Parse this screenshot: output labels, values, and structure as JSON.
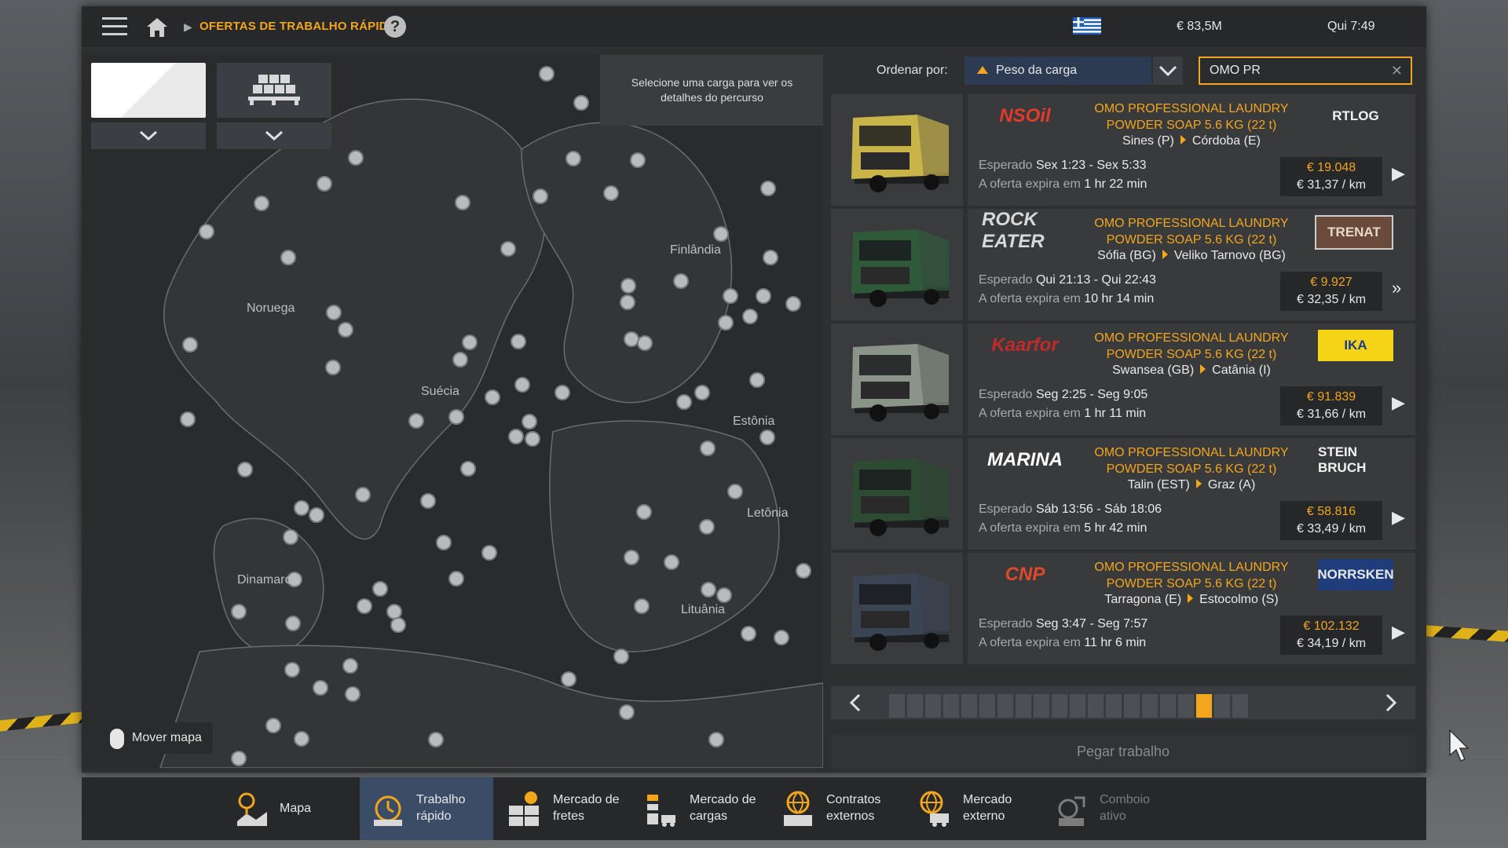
{
  "header": {
    "breadcrumb_title": "OFERTAS DE TRABALHO RÁPIDO",
    "help": "?",
    "money": "€ 83,5M",
    "time": "Qui 7:49"
  },
  "map": {
    "tooltip": "Selecione uma carga para ver os detalhes do percurso",
    "labels": [
      "Noruega",
      "Suécia",
      "Finlândia",
      "Estônia",
      "Letônia",
      "Lituânia",
      "Dinamarca"
    ],
    "move_map": "Mover mapa"
  },
  "sort": {
    "label": "Ordenar por:",
    "value": "Peso da carga"
  },
  "search": {
    "value": "OMO PR",
    "clear": "✕"
  },
  "jobs": [
    {
      "company": "NSOil",
      "cargo_line1": "OMO PROFESSIONAL LAUNDRY",
      "cargo_line2": "POWDER SOAP 5.6 KG (22 t)",
      "from": "Sines (P)",
      "to": "Córdoba (E)",
      "expected_label": "Esperado",
      "expected": "Sex 1:23 - Sex 5:33",
      "expires_label": "A oferta expira em",
      "expires": "1 hr 22 min",
      "price": "€ 19.048",
      "per_km": "€ 31,37 / km",
      "recipient": "RTLOG",
      "truck_color": "#c9b44a"
    },
    {
      "company": "ROCK EATER",
      "cargo_line1": "OMO PROFESSIONAL LAUNDRY",
      "cargo_line2": "POWDER SOAP 5.6 KG (22 t)",
      "from": "Sófia (BG)",
      "to": "Veliko Tarnovo (BG)",
      "expected_label": "Esperado",
      "expected": "Qui 21:13 - Qui 22:43",
      "expires_label": "A oferta expira em",
      "expires": "10 hr 14 min",
      "price": "€ 9.927",
      "per_km": "€ 32,35 / km",
      "recipient": "TRENAT",
      "truck_color": "#2f5a3a"
    },
    {
      "company": "Kaarfor",
      "cargo_line1": "OMO PROFESSIONAL LAUNDRY",
      "cargo_line2": "POWDER SOAP 5.6 KG (22 t)",
      "from": "Swansea (GB)",
      "to": "Catânia (I)",
      "expected_label": "Esperado",
      "expected": "Seg 2:25 - Seg 9:05",
      "expires_label": "A oferta expira em",
      "expires": "1 hr 11 min",
      "price": "€ 91.839",
      "per_km": "€ 31,66 / km",
      "recipient": "IKA",
      "truck_color": "#8a9488"
    },
    {
      "company": "MARINA",
      "cargo_line1": "OMO PROFESSIONAL LAUNDRY",
      "cargo_line2": "POWDER SOAP 5.6 KG (22 t)",
      "from": "Talin (EST)",
      "to": "Graz (A)",
      "expected_label": "Esperado",
      "expected": "Sáb 13:56 - Sáb 18:06",
      "expires_label": "A oferta expira em",
      "expires": "5 hr 42 min",
      "price": "€ 58.816",
      "per_km": "€ 33,49 / km",
      "recipient": "STEIN BRUCH",
      "truck_color": "#2d4a32"
    },
    {
      "company": "CNP",
      "cargo_line1": "OMO PROFESSIONAL LAUNDRY",
      "cargo_line2": "POWDER SOAP 5.6 KG (22 t)",
      "from": "Tarragona (E)",
      "to": "Estocolmo (S)",
      "expected_label": "Esperado",
      "expected": "Seg 3:47 - Seg 7:57",
      "expires_label": "A oferta expira em",
      "expires": "11 hr 6 min",
      "price": "€ 102.132",
      "per_km": "€ 34,19 / km",
      "recipient": "NORRSKEN",
      "truck_color": "#3a4452"
    }
  ],
  "pager": {
    "pages": 20,
    "active_page": 17
  },
  "take_job": "Pegar trabalho",
  "nav": [
    {
      "line1": "Mapa",
      "line2": "",
      "icon": "map-icon",
      "active": false,
      "disabled": false
    },
    {
      "line1": "Trabalho",
      "line2": "rápido",
      "icon": "stopwatch-icon",
      "active": true,
      "disabled": false
    },
    {
      "line1": "Mercado de",
      "line2": "fretes",
      "icon": "freight-icon",
      "active": false,
      "disabled": false
    },
    {
      "line1": "Mercado de",
      "line2": "cargas",
      "icon": "cargo-icon",
      "active": false,
      "disabled": false
    },
    {
      "line1": "Contratos",
      "line2": "externos",
      "icon": "globe-icon",
      "active": false,
      "disabled": false
    },
    {
      "line1": "Mercado",
      "line2": "externo",
      "icon": "globe-truck-icon",
      "active": false,
      "disabled": false
    },
    {
      "line1": "Comboio",
      "line2": "ativo",
      "icon": "convoy-icon",
      "active": false,
      "disabled": true
    }
  ],
  "colors": {
    "accent": "#f3a51e",
    "active_nav": "#3b4d66",
    "panel": "#2d2f31"
  }
}
